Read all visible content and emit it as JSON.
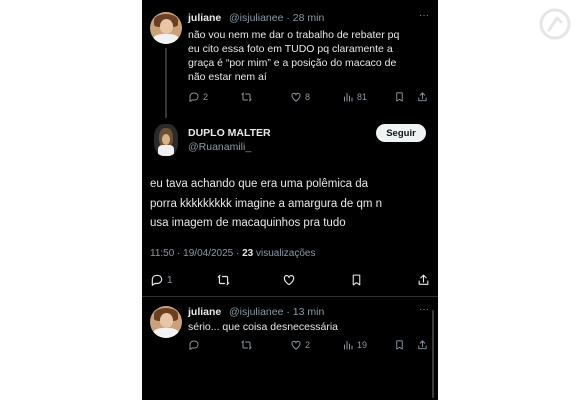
{
  "tweet1": {
    "name": "juliane",
    "handle": "@isjulianee",
    "time": "· 28 min",
    "lines": [
      "não vou nem me dar o trabalho de rebater pq",
      "eu cito essa foto em TUDO pq claramente a",
      "graça é “por mim” e a posição do macaco de",
      "não estar nem aí"
    ],
    "replies": "2",
    "likes": "8",
    "views": "81"
  },
  "main_tweet": {
    "name": "DUPLO MALTER",
    "handle": "@Ruanamili_",
    "follow_label": "Seguir",
    "lines": [
      "eu tava achando que era uma polêmica da",
      "porra kkkkkkkkk imagine a amargura de qm n",
      "usa imagem de macaquinhos pra tudo"
    ],
    "time": "11:50 · 19/04/2025 ·",
    "views_count": "23",
    "views_label": "visualizações",
    "replies": "1"
  },
  "tweet2": {
    "name": "juliane",
    "handle": "@isjulianee",
    "time": "· 13 min",
    "text": "sério... que coisa desnecessária",
    "likes": "2",
    "views": "19"
  },
  "icons": [
    "more-icon",
    "reply-icon",
    "retweet-icon",
    "like-icon",
    "views-icon",
    "bookmark-icon",
    "share-icon"
  ],
  "colors": {
    "background": "#000000",
    "text": "#e7e9ea",
    "muted": "#8b98a5",
    "follow_bg": "#eff3f4"
  }
}
